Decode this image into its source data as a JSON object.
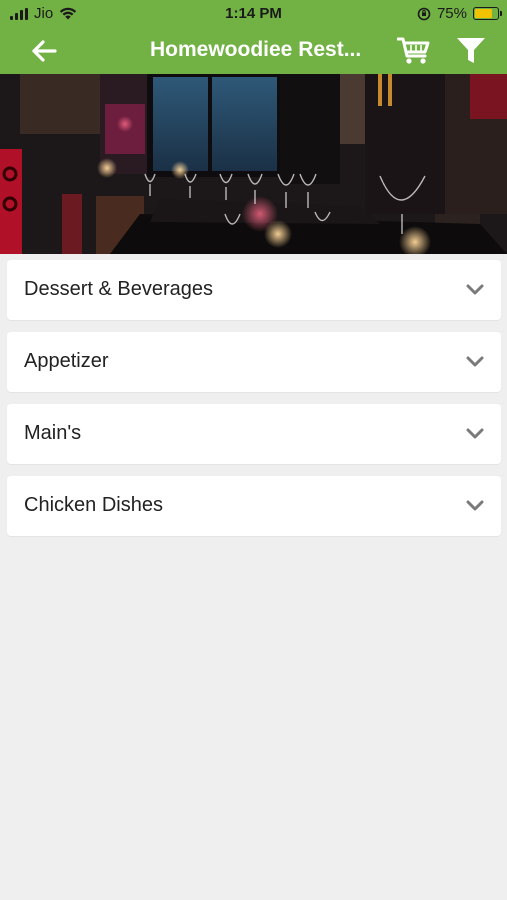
{
  "status_bar": {
    "carrier": "Jio",
    "time": "1:14 PM",
    "battery_percent": "75%",
    "battery_level": 0.75
  },
  "header": {
    "title": "Homewoodiee Rest...",
    "back_icon": "arrow-left-icon",
    "cart_icon": "cart-icon",
    "filter_icon": "filter-icon",
    "color": "#72b144"
  },
  "banner": {
    "image": "restaurant-interior-photo"
  },
  "categories": [
    {
      "label": "Dessert & Beverages"
    },
    {
      "label": "Appetizer"
    },
    {
      "label": "Main's"
    },
    {
      "label": "Chicken Dishes"
    }
  ]
}
